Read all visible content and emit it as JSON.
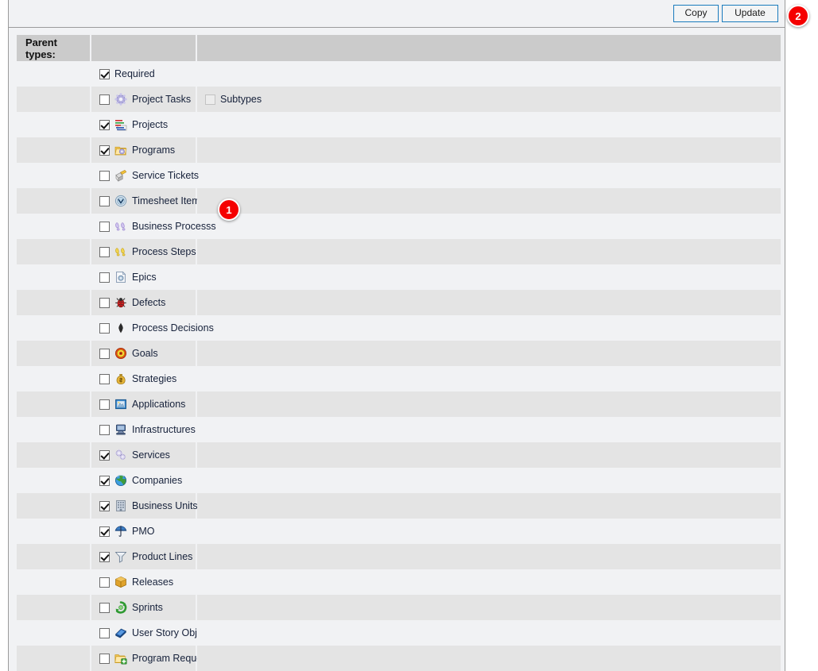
{
  "toolbar": {
    "copy_label": "Copy",
    "update_label": "Update"
  },
  "table": {
    "header": {
      "col1": "Parent types:",
      "col2": "",
      "col3": ""
    },
    "rows": [
      {
        "label": "Required",
        "checked": true,
        "icon": "none",
        "extra": null
      },
      {
        "label": "Project Tasks",
        "checked": false,
        "icon": "project-tasks",
        "extra": {
          "label": "Subtypes",
          "checked": false,
          "disabled": true
        }
      },
      {
        "label": "Projects",
        "checked": true,
        "icon": "projects",
        "extra": null
      },
      {
        "label": "Programs",
        "checked": true,
        "icon": "programs",
        "extra": null
      },
      {
        "label": "Service Tickets",
        "checked": false,
        "icon": "service-tickets",
        "extra": null
      },
      {
        "label": "Timesheet Items",
        "checked": false,
        "icon": "timesheet-items",
        "extra": null
      },
      {
        "label": "Business Processs",
        "checked": false,
        "icon": "business-process",
        "extra": null
      },
      {
        "label": "Process Steps",
        "checked": false,
        "icon": "process-steps",
        "extra": null
      },
      {
        "label": "Epics",
        "checked": false,
        "icon": "epics",
        "extra": null
      },
      {
        "label": "Defects",
        "checked": false,
        "icon": "defects",
        "extra": null
      },
      {
        "label": "Process Decisions",
        "checked": false,
        "icon": "process-decisions",
        "extra": null
      },
      {
        "label": "Goals",
        "checked": false,
        "icon": "goals",
        "extra": null
      },
      {
        "label": "Strategies",
        "checked": false,
        "icon": "strategies",
        "extra": null
      },
      {
        "label": "Applications",
        "checked": false,
        "icon": "applications",
        "extra": null
      },
      {
        "label": "Infrastructures",
        "checked": false,
        "icon": "infrastructures",
        "extra": null
      },
      {
        "label": "Services",
        "checked": true,
        "icon": "services",
        "extra": null
      },
      {
        "label": "Companies",
        "checked": true,
        "icon": "companies",
        "extra": null
      },
      {
        "label": "Business Units",
        "checked": true,
        "icon": "business-units",
        "extra": null
      },
      {
        "label": "PMO",
        "checked": true,
        "icon": "pmo",
        "extra": null
      },
      {
        "label": "Product Lines",
        "checked": true,
        "icon": "product-lines",
        "extra": null
      },
      {
        "label": "Releases",
        "checked": false,
        "icon": "releases",
        "extra": null
      },
      {
        "label": "Sprints",
        "checked": false,
        "icon": "sprints",
        "extra": null
      },
      {
        "label": "User Story Obj",
        "checked": false,
        "icon": "user-story-obj",
        "extra": null
      },
      {
        "label": "Program Requests",
        "checked": false,
        "icon": "program-requests",
        "extra": null
      }
    ]
  },
  "callouts": [
    {
      "number": "1"
    },
    {
      "number": "2"
    }
  ],
  "colors": {
    "badge": "#f50000",
    "button_border": "#1a7bbd",
    "header_bg": "#cbcbcb",
    "row_alt_bg": "#e4e4e4",
    "row_bg": "#f1f2f4"
  }
}
